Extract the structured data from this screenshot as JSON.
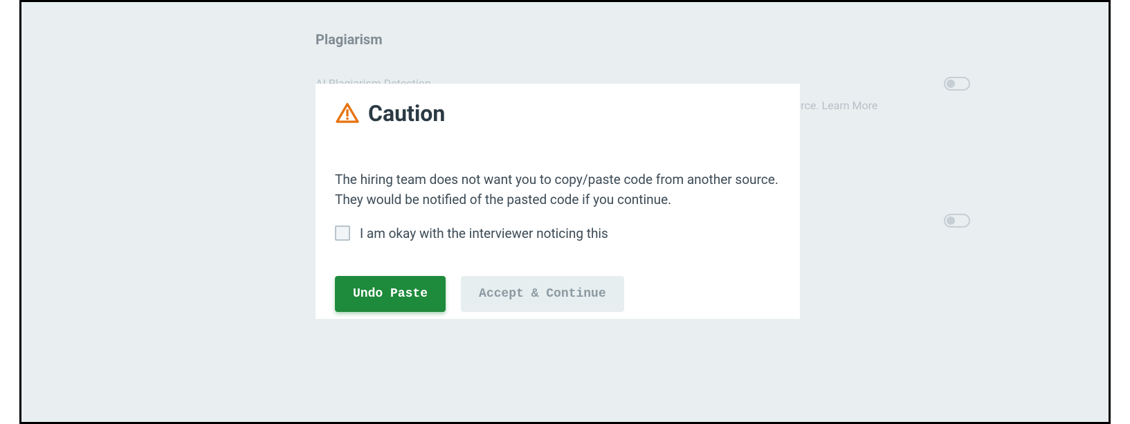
{
  "background": {
    "section_heading": "Plagiarism",
    "setting_label": "AI Plagiarism Detection",
    "right_snippet": "source. Learn More"
  },
  "modal": {
    "title": "Caution",
    "body": "The hiring team does not want you to copy/paste code from another source. They would be notified of the pasted code if you continue.",
    "checkbox_label": "I am okay with the interviewer noticing this",
    "undo_label": "Undo Paste",
    "accept_label": "Accept & Continue"
  }
}
